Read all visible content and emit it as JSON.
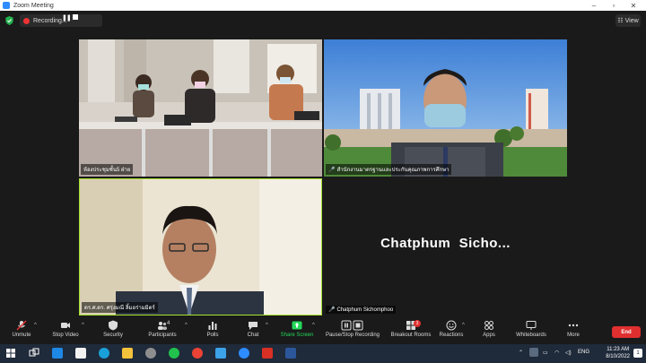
{
  "window": {
    "title": "Zoom Meeting"
  },
  "recording": {
    "label": "Recording..."
  },
  "view_button": {
    "label": "View"
  },
  "tiles": [
    {
      "name": "ห้องประชุมชั้น5 ฝ่าย"
    },
    {
      "name": "สำนักงานมาตรฐานและประกันคุณภาพการศึกษา"
    },
    {
      "name": "ดร.ศ.ดร. ศรุ่งมณี ลิ้มอร่ามมิตร์"
    },
    {
      "name": "Chatphum Sichomphoo",
      "display": "Chatphum  Sicho..."
    }
  ],
  "toolbar": {
    "items": [
      {
        "label": "Unmute",
        "icon": "mic-muted-icon"
      },
      {
        "label": "Stop Video",
        "icon": "video-camera-icon"
      },
      {
        "label": "Security",
        "icon": "shield-icon"
      },
      {
        "label": "Participants",
        "icon": "participants-icon",
        "count": "4"
      },
      {
        "label": "Polls",
        "icon": "polls-icon"
      },
      {
        "label": "Chat",
        "icon": "chat-icon"
      },
      {
        "label": "Share Screen",
        "icon": "share-screen-icon"
      },
      {
        "label": "Pause/Stop Recording",
        "icon": "pause-stop-icon"
      },
      {
        "label": "Breakout Rooms",
        "icon": "breakout-rooms-icon",
        "badge": "3"
      },
      {
        "label": "Reactions",
        "icon": "reactions-icon"
      },
      {
        "label": "Apps",
        "icon": "apps-icon"
      },
      {
        "label": "Whiteboards",
        "icon": "whiteboard-icon"
      },
      {
        "label": "More",
        "icon": "more-icon"
      }
    ],
    "end_label": "End"
  },
  "taskbar": {
    "language": "ENG",
    "time": "11:23 AM",
    "date": "8/10/2022",
    "notification_count": "1"
  },
  "colors": {
    "accent": "#2d8cff",
    "share": "#23d959",
    "end": "#e02f2f",
    "active_speaker": "#a6e22e"
  }
}
